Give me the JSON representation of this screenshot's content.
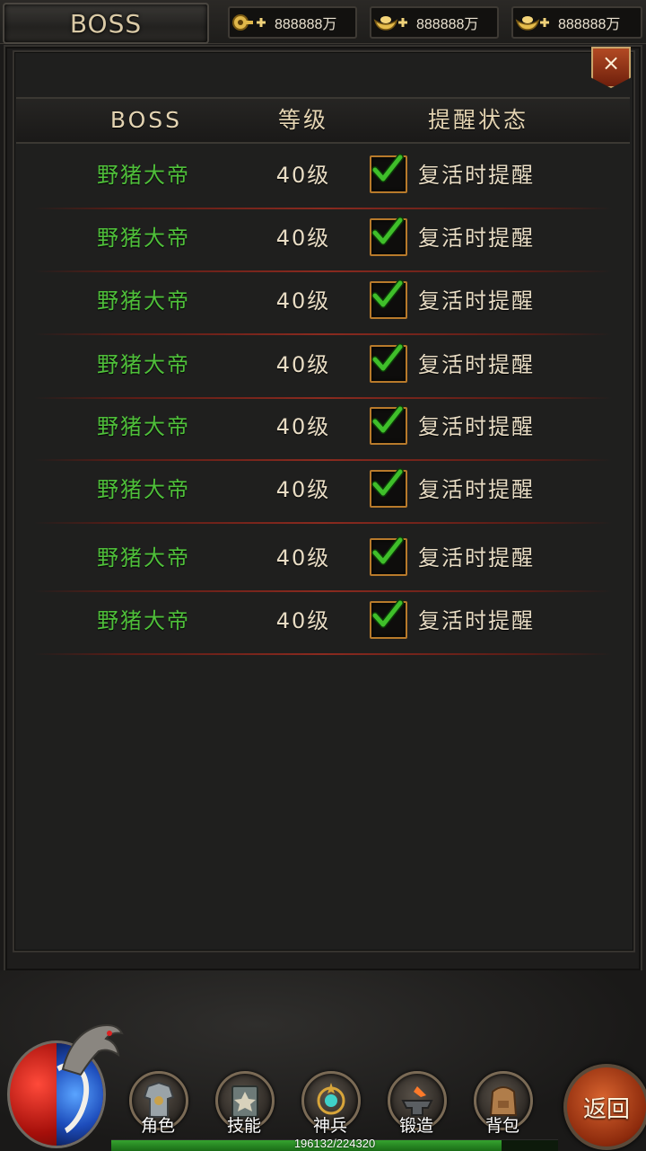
{
  "header": {
    "title": "BOSS",
    "currencies": [
      {
        "icon": "key-plus-icon",
        "value": "888888万"
      },
      {
        "icon": "gold-ingot-plus-icon",
        "value": "888888万"
      },
      {
        "icon": "gold-ingot-plus-icon",
        "value": "888888万"
      }
    ]
  },
  "table": {
    "columns": [
      "BOSS",
      "等级",
      "提醒状态"
    ],
    "rows": [
      {
        "name": "野猪大帝",
        "level": "40级",
        "status": "复活时提醒",
        "checked": true
      },
      {
        "name": "野猪大帝",
        "level": "40级",
        "status": "复活时提醒",
        "checked": true
      },
      {
        "name": "野猪大帝",
        "level": "40级",
        "status": "复活时提醒",
        "checked": true
      },
      {
        "name": "野猪大帝",
        "level": "40级",
        "status": "复活时提醒",
        "checked": true
      },
      {
        "name": "野猪大帝",
        "level": "40级",
        "status": "复活时提醒",
        "checked": true
      },
      {
        "name": "野猪大帝",
        "level": "40级",
        "status": "复活时提醒",
        "checked": true
      },
      {
        "name": "野猪大帝",
        "level": "40级",
        "status": "复活时提醒",
        "checked": true
      },
      {
        "name": "野猪大帝",
        "level": "40级",
        "status": "复活时提醒",
        "checked": true
      }
    ]
  },
  "close_icon": "×",
  "nav": {
    "items": [
      {
        "label": "角色",
        "icon": "armor-icon"
      },
      {
        "label": "技能",
        "icon": "skill-book-icon"
      },
      {
        "label": "神兵",
        "icon": "divine-weapon-icon"
      },
      {
        "label": "锻造",
        "icon": "anvil-icon"
      },
      {
        "label": "背包",
        "icon": "backpack-icon"
      }
    ],
    "return_label": "返回"
  },
  "exp": {
    "text": "196132/224320",
    "current": 196132,
    "max": 224320
  },
  "colors": {
    "name_green": "#4fbf3a",
    "check_green": "#3fbf2a",
    "accent_orange": "#b87a2b"
  }
}
